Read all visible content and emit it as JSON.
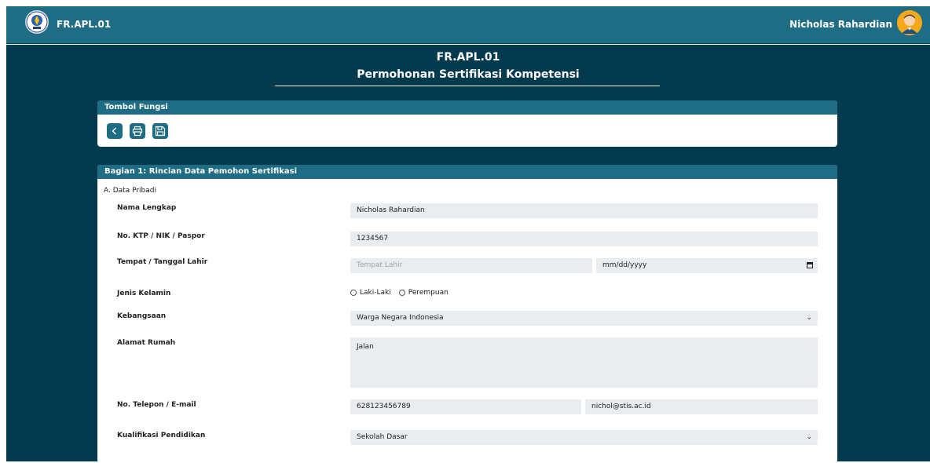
{
  "header": {
    "brand": "FR.APL.01",
    "username": "Nicholas Rahardian",
    "logo_icon": "stis-logo-icon",
    "avatar_icon": "user-avatar-icon"
  },
  "page": {
    "title": "FR.APL.01",
    "subtitle": "Permohonan Sertifikasi Kompetensi"
  },
  "toolbar": {
    "heading": "Tombol Fungsi",
    "buttons": [
      {
        "icon": "back-icon"
      },
      {
        "icon": "print-icon"
      },
      {
        "icon": "save-icon"
      }
    ]
  },
  "section1": {
    "heading": "Bagian 1: Rincian Data Pemohon Sertifikasi",
    "subheading": "A. Data Pribadi",
    "fields": {
      "nama": {
        "label": "Nama Lengkap",
        "value": "Nicholas Rahardian"
      },
      "ktp": {
        "label": "No. KTP / NIK / Paspor",
        "value": "1234567"
      },
      "ttl": {
        "label": "Tempat / Tanggal Lahir",
        "placeholder": "Tempat Lahir",
        "date_value": "mm/dd/yyyy"
      },
      "gender": {
        "label": "Jenis Kelamin",
        "options": [
          "Laki-Laki",
          "Perempuan"
        ]
      },
      "kebangsaan": {
        "label": "Kebangsaan",
        "value": "Warga Negara Indonesia"
      },
      "alamat": {
        "label": "Alamat Rumah",
        "value": "Jalan"
      },
      "kontak": {
        "label": "No. Telepon / E-mail",
        "phone": "628123456789",
        "email": "nichol@stis.ac.id"
      },
      "pendidikan": {
        "label": "Kualifikasi Pendidikan",
        "value": "Sekolah Dasar"
      }
    }
  },
  "colors": {
    "header": "#1f6d84",
    "background": "#033a4e",
    "field": "#e9edf0",
    "avatar": "#f6a81b"
  }
}
